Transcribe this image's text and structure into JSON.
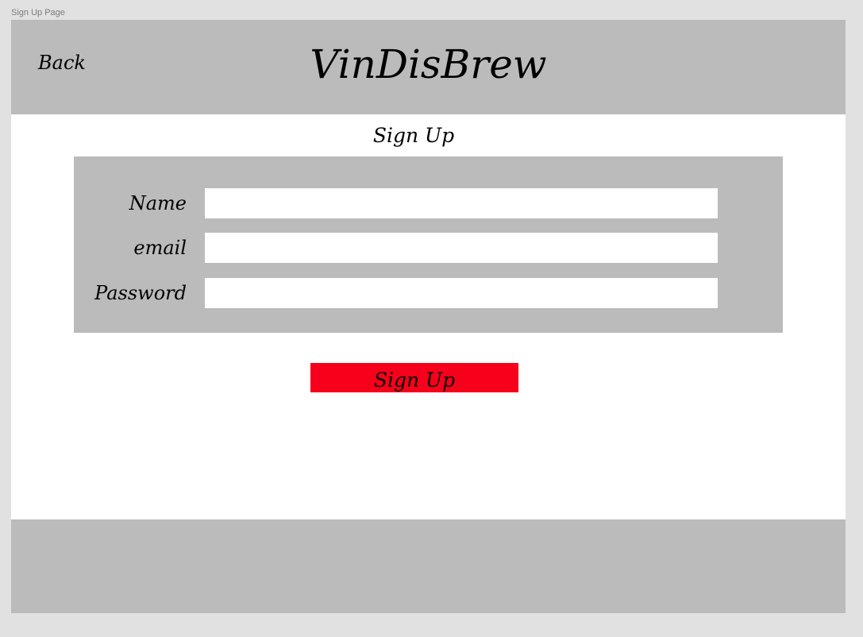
{
  "frame": {
    "label": "Sign Up Page"
  },
  "header": {
    "back_label": "Back",
    "brand": "VinDisBrew"
  },
  "main": {
    "title": "Sign Up",
    "form": {
      "fields": [
        {
          "label": "Name",
          "value": "",
          "placeholder": ""
        },
        {
          "label": "email",
          "value": "",
          "placeholder": ""
        },
        {
          "label": "Password",
          "value": "",
          "placeholder": ""
        }
      ]
    },
    "submit_label": "Sign Up"
  },
  "colors": {
    "page_background": "#e1e1e1",
    "bar_gray": "#bbbbbb",
    "content_white": "#ffffff",
    "button_red": "#f6001b"
  }
}
